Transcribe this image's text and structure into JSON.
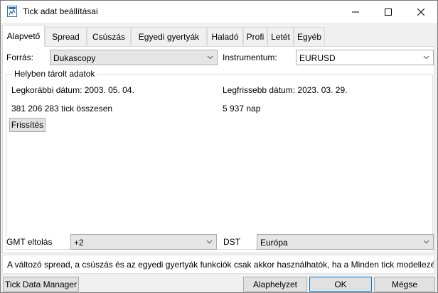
{
  "window": {
    "title": "Tick adat beállításai"
  },
  "tabs": [
    {
      "label": "Alapvető"
    },
    {
      "label": "Spread"
    },
    {
      "label": "Csúszás"
    },
    {
      "label": "Egyedi gyertyák"
    },
    {
      "label": "Haladó"
    },
    {
      "label": "Profi"
    },
    {
      "label": "Letét"
    },
    {
      "label": "Egyéb"
    }
  ],
  "source": {
    "label": "Forrás:",
    "value": "Dukascopy"
  },
  "instrument": {
    "label": "Instrumentum:",
    "value": "EURUSD"
  },
  "local_data": {
    "title": "Helyben tárolt adatok",
    "earliest": "Legkorábbi dátum: 2003. 05. 04.",
    "latest": "Legfrissebb dátum: 2023. 03. 29.",
    "tick_count": "381 206 283 tick összesen",
    "days": "5 937 nap",
    "refresh_label": "Frissítés"
  },
  "gmt": {
    "label": "GMT eltolás",
    "value": "+2"
  },
  "dst": {
    "label": "DST",
    "value": "Európa"
  },
  "notice": "A változó spread, a csúszás és az egyedi gyertyák funkciók csak akkor használhatók, ha a Minden tick modellezési",
  "footer": {
    "tick_data_manager": "Tick Data Manager",
    "reset": "Alaphelyzet",
    "ok": "OK",
    "cancel": "Mégse"
  }
}
